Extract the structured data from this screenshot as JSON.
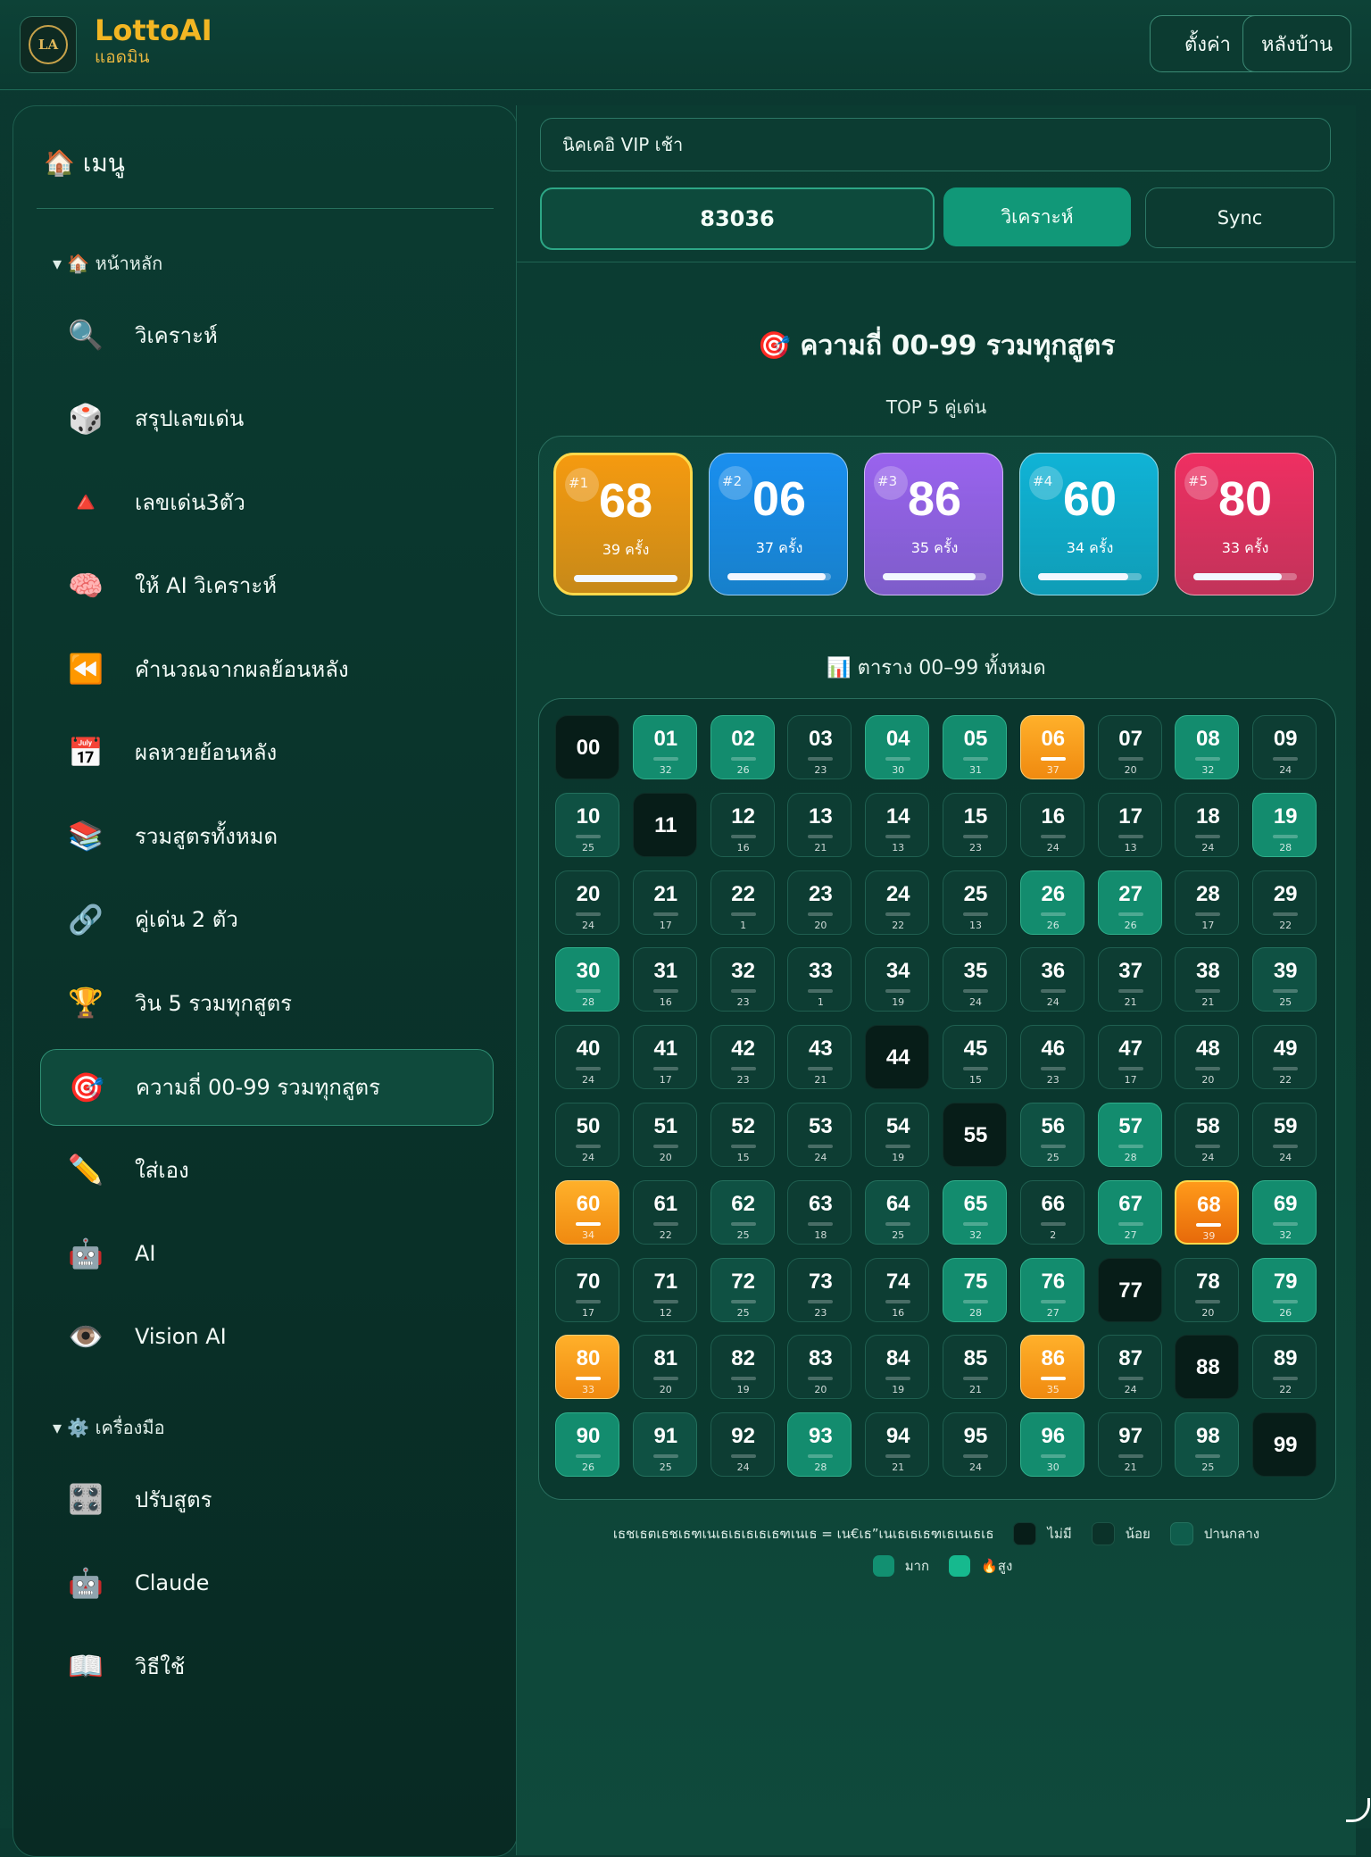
{
  "header": {
    "logo_text": "LA",
    "app_name": "LottoAI",
    "subtitle": "แอดมิน",
    "settings_label": "ตั้งค่า",
    "back_label": "หลังบ้าน"
  },
  "sidebar": {
    "menu_title": "🏠 เมนู",
    "section_main": "▾ 🏠 หน้าหลัก",
    "section_tools": "▾ ⚙️ เครื่องมือ",
    "main_items": [
      {
        "icon": "🔍",
        "label": "วิเคราะห์"
      },
      {
        "icon": "🎲",
        "label": "สรุปเลขเด่น"
      },
      {
        "icon": "🔺",
        "label": "เลขเด่น3ตัว"
      },
      {
        "icon": "🧠",
        "label": "ให้ AI วิเคราะห์"
      },
      {
        "icon": "⏪",
        "label": "คำนวณจากผลย้อนหลัง"
      },
      {
        "icon": "📅",
        "label": "ผลหวยย้อนหลัง"
      },
      {
        "icon": "📚",
        "label": "รวมสูตรทั้งหมด"
      },
      {
        "icon": "🔗",
        "label": "คู่เด่น 2 ตัว"
      },
      {
        "icon": "🏆",
        "label": "วิน 5 รวมทุกสูตร"
      },
      {
        "icon": "🎯",
        "label": "ความถี่ 00-99 รวมทุกสูตร"
      },
      {
        "icon": "✏️",
        "label": "ใส่เอง"
      },
      {
        "icon": "🤖",
        "label": "AI"
      },
      {
        "icon": "👁️",
        "label": "Vision AI"
      }
    ],
    "tool_items": [
      {
        "icon": "🎛️",
        "label": "ปรับสูตร"
      },
      {
        "icon": "🤖",
        "label": "Claude"
      },
      {
        "icon": "📖",
        "label": "วิธีใช้"
      }
    ],
    "active_item": "ความถี่ 00-99 รวมทุกสูตร"
  },
  "topbar": {
    "source_value": "นิคเคอิ VIP เช้า",
    "number_value": "83036",
    "analyze_label": "วิเคราะห์",
    "sync_label": "Sync"
  },
  "main": {
    "title": "🎯 ความถี่ 00-99 รวมทุกสูตร",
    "top5_label": "TOP 5 คู่เด่น",
    "grid_title": "📊 ตาราง 00–99 ทั้งหมด"
  },
  "top5": [
    {
      "rank": "#1",
      "number": "68",
      "count_label": "39 ครั้ง",
      "fraction": 1.0,
      "color": "#f59a10"
    },
    {
      "rank": "#2",
      "number": "06",
      "count_label": "37 ครั้ง",
      "fraction": 0.95,
      "color": "#1a8fef"
    },
    {
      "rank": "#3",
      "number": "86",
      "count_label": "35 ครั้ง",
      "fraction": 0.9,
      "color": "#9a63ee"
    },
    {
      "rank": "#4",
      "number": "60",
      "count_label": "34 ครั้ง",
      "fraction": 0.87,
      "color": "#10b3d6"
    },
    {
      "rank": "#5",
      "number": "80",
      "count_label": "33 ครั้ง",
      "fraction": 0.85,
      "color": "#ef2f62"
    }
  ],
  "frequency": [
    0,
    32,
    26,
    23,
    30,
    31,
    37,
    20,
    32,
    24,
    25,
    0,
    16,
    21,
    13,
    23,
    24,
    13,
    24,
    28,
    24,
    17,
    1,
    20,
    22,
    13,
    26,
    26,
    17,
    22,
    28,
    16,
    23,
    1,
    19,
    24,
    24,
    21,
    21,
    25,
    24,
    17,
    23,
    21,
    0,
    15,
    23,
    17,
    20,
    22,
    24,
    20,
    15,
    24,
    19,
    0,
    25,
    28,
    24,
    24,
    34,
    22,
    25,
    18,
    25,
    32,
    2,
    27,
    39,
    32,
    17,
    12,
    25,
    23,
    16,
    28,
    27,
    0,
    20,
    26,
    33,
    20,
    19,
    20,
    19,
    21,
    35,
    24,
    0,
    22,
    26,
    25,
    24,
    28,
    21,
    24,
    30,
    21,
    25,
    0
  ],
  "legend": {
    "prefix": "เธชเธตเธชเธฑเนเธเธเธเธเธฑเนเธ = เน€เธ”เนเธเธเธฑเธเนเธเธ",
    "items": [
      "ไม่มี",
      "น้อย",
      "ปานกลาง",
      "มาก",
      "🔥สูง"
    ]
  },
  "colors": {
    "accent": "#119878",
    "brand": "#f2b623",
    "hot": "#f5a21a"
  }
}
